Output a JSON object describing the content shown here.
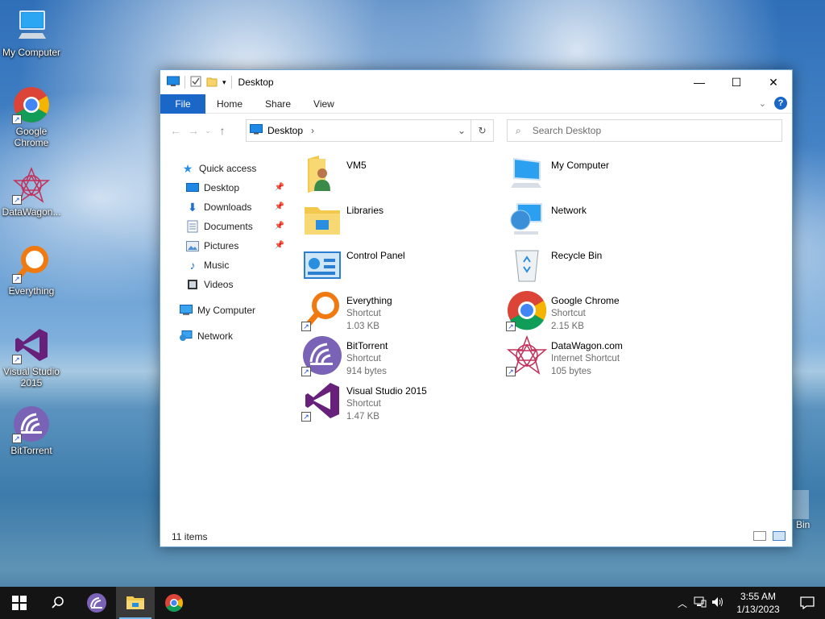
{
  "desktop": {
    "icons": [
      {
        "label": "My Computer"
      },
      {
        "label": "Google Chrome"
      },
      {
        "label": "DataWagon..."
      },
      {
        "label": "Everything"
      },
      {
        "label": "Visual Studio 2015"
      },
      {
        "label": "BitTorrent"
      }
    ],
    "partial_bin_label": "Bin"
  },
  "window": {
    "title": "Desktop",
    "controls": {
      "minimize": "—",
      "maximize": "☐",
      "close": "✕"
    },
    "ribbon": {
      "file": "File",
      "home": "Home",
      "share": "Share",
      "view": "View",
      "help": "?"
    },
    "address": {
      "crumb": "Desktop",
      "chevron": "›"
    },
    "search": {
      "placeholder": "Search Desktop"
    },
    "nav_pane": [
      {
        "label": "Quick access",
        "icon": "star-icon"
      },
      {
        "label": "Desktop",
        "icon": "desktop-icon",
        "pinned": true
      },
      {
        "label": "Downloads",
        "icon": "download-icon",
        "pinned": true
      },
      {
        "label": "Documents",
        "icon": "documents-icon",
        "pinned": true
      },
      {
        "label": "Pictures",
        "icon": "pictures-icon",
        "pinned": true
      },
      {
        "label": "Music",
        "icon": "music-icon"
      },
      {
        "label": "Videos",
        "icon": "videos-icon"
      },
      {
        "label": "My Computer",
        "icon": "computer-icon"
      },
      {
        "label": "Network",
        "icon": "network-icon"
      }
    ],
    "items": [
      {
        "name": "VM5",
        "type": "",
        "size": ""
      },
      {
        "name": "My Computer",
        "type": "",
        "size": ""
      },
      {
        "name": "Libraries",
        "type": "",
        "size": ""
      },
      {
        "name": "Network",
        "type": "",
        "size": ""
      },
      {
        "name": "Control Panel",
        "type": "",
        "size": ""
      },
      {
        "name": "Recycle Bin",
        "type": "",
        "size": ""
      },
      {
        "name": "Everything",
        "type": "Shortcut",
        "size": "1.03 KB"
      },
      {
        "name": "Google Chrome",
        "type": "Shortcut",
        "size": "2.15 KB"
      },
      {
        "name": "BitTorrent",
        "type": "Shortcut",
        "size": "914 bytes"
      },
      {
        "name": "DataWagon.com",
        "type": "Internet Shortcut",
        "size": "105 bytes"
      },
      {
        "name": "Visual Studio 2015",
        "type": "Shortcut",
        "size": "1.47 KB"
      }
    ],
    "status": "11 items"
  },
  "taskbar": {
    "time": "3:55 AM",
    "date": "1/13/2023"
  },
  "colors": {
    "accent": "#1a67c7",
    "taskbar": "#141414"
  }
}
